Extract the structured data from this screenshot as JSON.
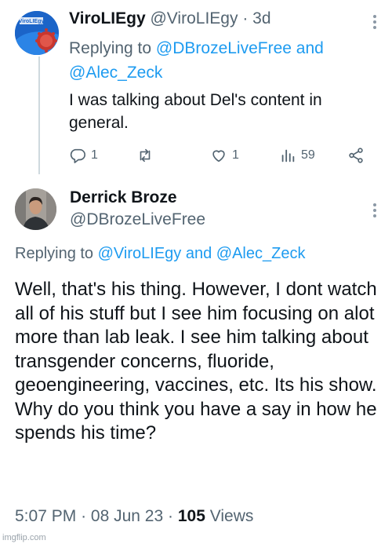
{
  "tweet1": {
    "display_name": "ViroLIEgy",
    "handle": "@ViroLIEgy",
    "separator": "·",
    "age": "3d",
    "replying_label": "Replying to",
    "reply_user1": "@DBrozeLiveFree",
    "reply_and": "and",
    "reply_user2": "@Alec_Zeck",
    "text": "I was talking about Del's content in general.",
    "counts": {
      "replies": "1",
      "retweets": "",
      "likes": "1",
      "views": "59"
    },
    "avatar_text": "ViroLIEgy"
  },
  "tweet2": {
    "display_name": "Derrick Broze",
    "handle": "@DBrozeLiveFree",
    "replying_label": "Replying to",
    "reply_user1": "@ViroLIEgy",
    "reply_and": "and",
    "reply_user2": "@Alec_Zeck",
    "text": "Well, that's his thing. However, I dont watch all of his stuff but I see him focusing on alot more than lab leak. I see him talking about transgender concerns, fluoride, geoengineering, vaccines, etc. Its his show. Why do you think you have a say in how he spends his time?",
    "time": "5:07 PM",
    "date": "08 Jun 23",
    "dot": "·",
    "view_count": "105",
    "views_label": "Views"
  },
  "watermark": "imgflip.com",
  "colors": {
    "link": "#1d9bf0",
    "muted": "#536471",
    "text": "#0f1419"
  },
  "icons": [
    "reply-icon",
    "retweet-icon",
    "like-icon",
    "views-icon",
    "share-icon",
    "more-icon"
  ]
}
